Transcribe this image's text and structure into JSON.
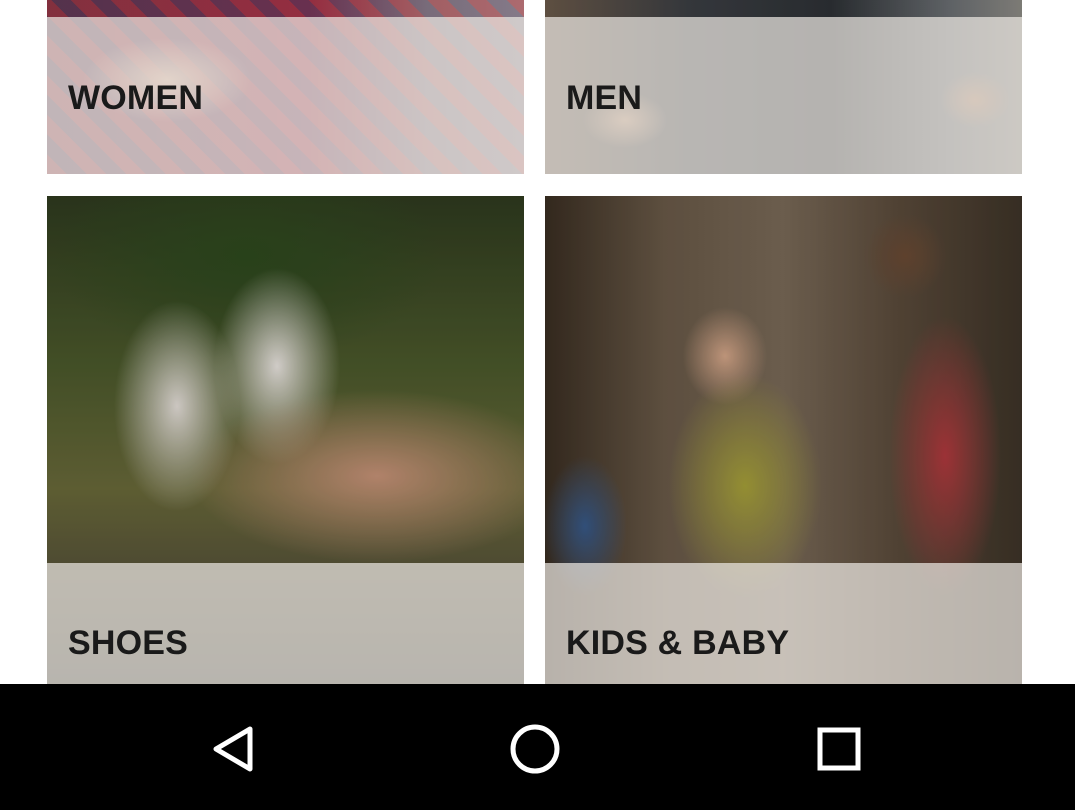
{
  "categories": [
    {
      "id": "women",
      "label": "WOMEN"
    },
    {
      "id": "men",
      "label": "MEN"
    },
    {
      "id": "shoes",
      "label": "SHOES"
    },
    {
      "id": "kids",
      "label": "KIDS & BABY"
    }
  ],
  "navigation_bar": {
    "back_icon": "back-triangle-icon",
    "home_icon": "home-circle-icon",
    "recents_icon": "recents-square-icon",
    "icon_color": "#ffffff",
    "background": "#000000"
  }
}
